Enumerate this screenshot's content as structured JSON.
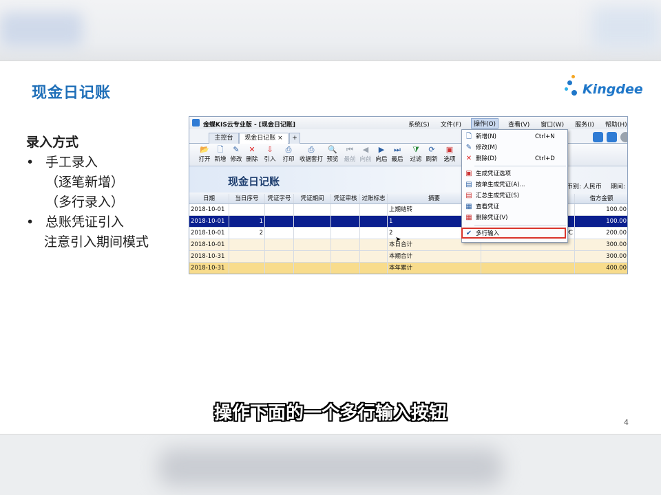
{
  "slide": {
    "title": "现金日记账",
    "logo_text": "Kingdee",
    "bullets": {
      "heading": "录入方式",
      "item1": "手工录入",
      "item1_sub1": "（逐笔新增）",
      "item1_sub2": "（多行录入）",
      "item2": "总账凭证引入",
      "item2_note": "注意引入期间模式"
    },
    "page_number": "4",
    "caption": "操作下面的一个多行输入按钮"
  },
  "app": {
    "window_title": "金蝶KIS云专业版 - [现金日记账]",
    "menus": [
      "系统(S)",
      "文件(F)",
      "操作(O)",
      "查看(V)",
      "窗口(W)",
      "服务(I)",
      "帮助(H)"
    ],
    "tabs": [
      "主控台",
      "现金日记账 ×"
    ],
    "toolbar": [
      "打开",
      "新增",
      "修改",
      "删除",
      "引入",
      "打印",
      "收据套打",
      "预览",
      "最前",
      "向前",
      "向后",
      "最后",
      "过滤",
      "刷新",
      "选项"
    ],
    "banner_title": "现金日记账",
    "currency_label": "币别: 人民币",
    "period_label": "期间:",
    "columns": [
      "日期",
      "当日序号",
      "凭证字号",
      "凭证期间",
      "凭证审核",
      "过账标志",
      "摘要",
      "",
      "借方金额"
    ],
    "rows": [
      {
        "date": "2018-10-01",
        "seq": "",
        "summary": "上期结转",
        "extra": "",
        "amount": "100.00",
        "style": "normal"
      },
      {
        "date": "2018-10-01",
        "seq": "1",
        "summary": "1",
        "extra": "",
        "amount": "100.00",
        "style": "sel"
      },
      {
        "date": "2018-10-01",
        "seq": "2",
        "summary": "2",
        "extra": "⁄C",
        "amount": "200.00",
        "style": "normal"
      },
      {
        "date": "2018-10-01",
        "seq": "",
        "summary": "本日合计",
        "extra": "",
        "amount": "300.00",
        "style": "sub"
      },
      {
        "date": "2018-10-31",
        "seq": "",
        "summary": "本期合计",
        "extra": "",
        "amount": "300.00",
        "style": "sub"
      },
      {
        "date": "2018-10-31",
        "seq": "",
        "summary": "本年累计",
        "extra": "",
        "amount": "400.00",
        "style": "year"
      }
    ],
    "operation_menu": [
      {
        "icon": "new-doc-icon",
        "label": "新增(N)",
        "shortcut": "Ctrl+N"
      },
      {
        "icon": "edit-icon",
        "label": "修改(M)",
        "shortcut": ""
      },
      {
        "icon": "delete-icon",
        "label": "删除(D)",
        "shortcut": "Ctrl+D"
      },
      {
        "icon": "generate-voucher-option-icon",
        "label": "生成凭证选项",
        "shortcut": ""
      },
      {
        "icon": "single-voucher-icon",
        "label": "按单生成凭证(A)...",
        "shortcut": ""
      },
      {
        "icon": "summary-voucher-icon",
        "label": "汇总生成凭证(S)",
        "shortcut": ""
      },
      {
        "icon": "view-voucher-icon",
        "label": "查看凭证",
        "shortcut": ""
      },
      {
        "icon": "delete-voucher-icon",
        "label": "删除凭证(V)",
        "shortcut": ""
      },
      {
        "icon": "check-icon",
        "label": "多行输入",
        "shortcut": ""
      }
    ]
  },
  "colors": {
    "title_blue": "#1f6fb8",
    "selected_row": "#0a1f8f",
    "highlight_box": "#d9342b",
    "year_row": "#f8dc8c"
  }
}
